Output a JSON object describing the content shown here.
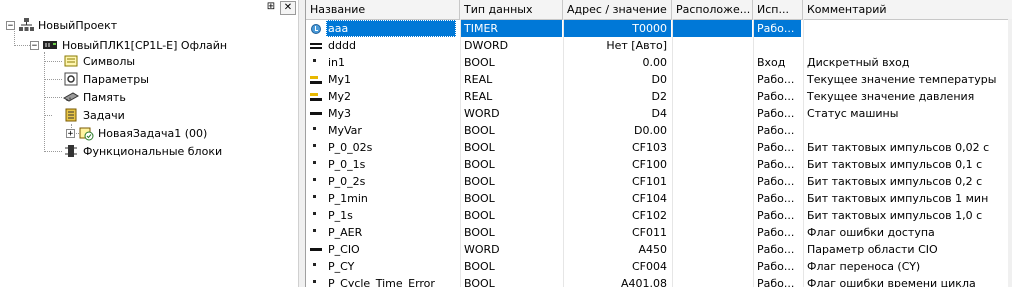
{
  "tree": {
    "project": "НовыйПроект",
    "plc": "НовыйПЛК1[CP1L-E] Офлайн",
    "items": [
      {
        "label": "Символы",
        "icon": "symbols-icon"
      },
      {
        "label": "Параметры",
        "icon": "settings-icon"
      },
      {
        "label": "Память",
        "icon": "memory-icon"
      },
      {
        "label": "Задачи",
        "icon": "tasks-icon"
      },
      {
        "label": "НоваяЗадача1 (00)",
        "icon": "task-icon"
      },
      {
        "label": "Функциональные блоки",
        "icon": "function-blocks-icon"
      }
    ],
    "pane_buttons": {
      "pin": "⊞",
      "close": "✕"
    }
  },
  "table": {
    "columns": [
      "Название",
      "Тип данных",
      "Адрес / значение",
      "Расположе...",
      "Исп...",
      "Комментарий"
    ],
    "rows": [
      {
        "icon": "timer",
        "name": "aaa",
        "type": "TIMER",
        "addr": "T0000",
        "loc": "",
        "use": "Рабо...",
        "comment": "",
        "selected": true
      },
      {
        "icon": "dword",
        "name": "dddd",
        "type": "DWORD",
        "addr": "Нет [Авто]",
        "loc": "",
        "use": "",
        "comment": ""
      },
      {
        "icon": "bool",
        "name": "in1",
        "type": "BOOL",
        "addr": "0.00",
        "loc": "",
        "use": "Вход",
        "comment": "Дискретный вход"
      },
      {
        "icon": "real",
        "name": "My1",
        "type": "REAL",
        "addr": "D0",
        "loc": "",
        "use": "Рабо...",
        "comment": "Текущее значение температуры"
      },
      {
        "icon": "real",
        "name": "My2",
        "type": "REAL",
        "addr": "D2",
        "loc": "",
        "use": "Рабо...",
        "comment": "Текущее значение давления"
      },
      {
        "icon": "word",
        "name": "My3",
        "type": "WORD",
        "addr": "D4",
        "loc": "",
        "use": "Рабо...",
        "comment": "Статус машины"
      },
      {
        "icon": "bool",
        "name": "MyVar",
        "type": "BOOL",
        "addr": "D0.00",
        "loc": "",
        "use": "Рабо...",
        "comment": ""
      },
      {
        "icon": "bool",
        "name": "P_0_02s",
        "type": "BOOL",
        "addr": "CF103",
        "loc": "",
        "use": "Рабо...",
        "comment": "Бит тактовых импульсов 0,02 с"
      },
      {
        "icon": "bool",
        "name": "P_0_1s",
        "type": "BOOL",
        "addr": "CF100",
        "loc": "",
        "use": "Рабо...",
        "comment": "Бит тактовых импульсов 0,1 с"
      },
      {
        "icon": "bool",
        "name": "P_0_2s",
        "type": "BOOL",
        "addr": "CF101",
        "loc": "",
        "use": "Рабо...",
        "comment": "Бит тактовых импульсов 0,2 с"
      },
      {
        "icon": "bool",
        "name": "P_1min",
        "type": "BOOL",
        "addr": "CF104",
        "loc": "",
        "use": "Рабо...",
        "comment": "Бит тактовых импульсов 1 мин"
      },
      {
        "icon": "bool",
        "name": "P_1s",
        "type": "BOOL",
        "addr": "CF102",
        "loc": "",
        "use": "Рабо...",
        "comment": "Бит тактовых импульсов 1,0 с"
      },
      {
        "icon": "bool",
        "name": "P_AER",
        "type": "BOOL",
        "addr": "CF011",
        "loc": "",
        "use": "Рабо...",
        "comment": "Флаг ошибки доступа"
      },
      {
        "icon": "word",
        "name": "P_CIO",
        "type": "WORD",
        "addr": "A450",
        "loc": "",
        "use": "Рабо...",
        "comment": "Параметр области CIO"
      },
      {
        "icon": "bool",
        "name": "P_CY",
        "type": "BOOL",
        "addr": "CF004",
        "loc": "",
        "use": "Рабо...",
        "comment": "Флаг переноса (CY)"
      },
      {
        "icon": "bool",
        "name": "P_Cycle_Time_Error",
        "type": "BOOL",
        "addr": "A401.08",
        "loc": "",
        "use": "Рабо...",
        "comment": "Флаг ошибки времени цикла"
      }
    ]
  },
  "colors": {
    "selection": "#0078d7",
    "header_bg": "#f4f4f4"
  }
}
